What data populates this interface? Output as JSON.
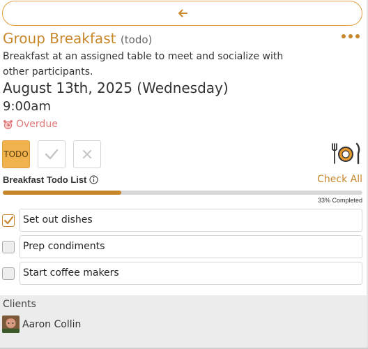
{
  "header": {
    "back_icon": "arrow-left-icon",
    "accent_color": "#c8862a"
  },
  "event": {
    "title": "Group Breakfast",
    "type": "(todo)",
    "description": "Breakfast at an assigned table to meet and socialize with other participants.",
    "date": "August 13th, 2025 (Wednesday)",
    "time": "9:00am",
    "status_text": "Overdue",
    "status_icon": "alarm-clock-icon"
  },
  "status_buttons": {
    "todo_label": "TODO",
    "done_icon": "checkmark-icon",
    "cancel_icon": "x-icon"
  },
  "todo_list": {
    "title": "Breakfast Todo List",
    "check_all_label": "Check All",
    "progress": 0.33,
    "progress_text": "33% Completed",
    "items": [
      {
        "label": "Set out dishes",
        "checked": true
      },
      {
        "label": "Prep condiments",
        "checked": false
      },
      {
        "label": "Start coffee makers",
        "checked": false
      }
    ]
  },
  "clients": {
    "label": "Clients",
    "list": [
      {
        "name": "Aaron Collin"
      }
    ]
  }
}
